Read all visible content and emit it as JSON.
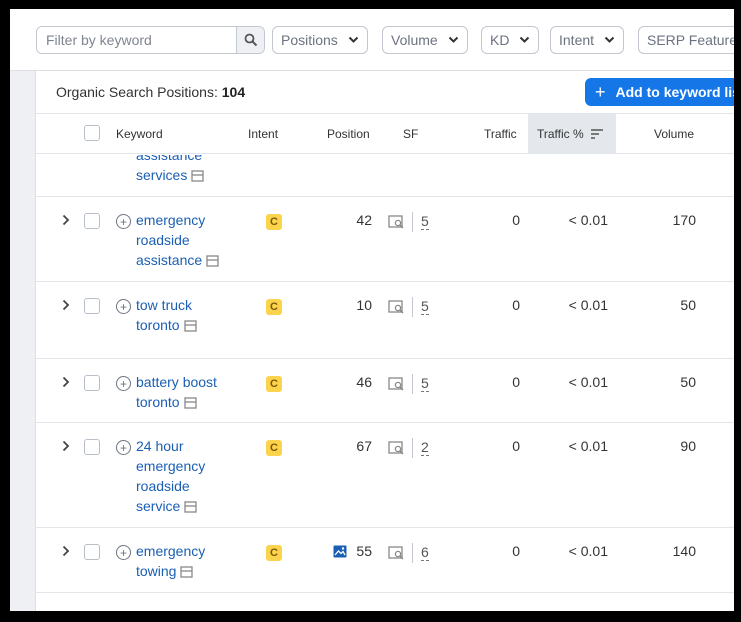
{
  "filters": {
    "search_placeholder": "Filter by keyword",
    "buttons": [
      "Positions",
      "Volume",
      "KD",
      "Intent",
      "SERP Features"
    ]
  },
  "summary": {
    "label": "Organic Search Positions:",
    "count": "104",
    "add_button": "Add to keyword list"
  },
  "table": {
    "headers": {
      "keyword": "Keyword",
      "intent": "Intent",
      "position": "Position",
      "sf": "SF",
      "traffic": "Traffic",
      "traffic_pct": "Traffic %",
      "volume": "Volume"
    },
    "partial_row": {
      "keyword": "assistance services"
    },
    "rows": [
      {
        "keyword": "emergency roadside assistance",
        "intent": "C",
        "position": "42",
        "sf": "5",
        "traffic": "0",
        "traffic_pct": "< 0.01",
        "volume": "170"
      },
      {
        "keyword": "tow truck toronto",
        "intent": "C",
        "position": "10",
        "sf": "5",
        "traffic": "0",
        "traffic_pct": "< 0.01",
        "volume": "50"
      },
      {
        "keyword": "battery boost toronto",
        "intent": "C",
        "position": "46",
        "sf": "5",
        "traffic": "0",
        "traffic_pct": "< 0.01",
        "volume": "50"
      },
      {
        "keyword": "24 hour emergency roadside service",
        "intent": "C",
        "position": "67",
        "sf": "2",
        "traffic": "0",
        "traffic_pct": "< 0.01",
        "volume": "90"
      },
      {
        "keyword": "emergency towing",
        "intent": "C",
        "position": "55",
        "sf": "6",
        "traffic": "0",
        "traffic_pct": "< 0.01",
        "volume": "140"
      }
    ]
  },
  "icons": {
    "search": "search-icon",
    "chevron": "chevron-down-icon",
    "expand": "chevron-right-icon",
    "add": "plus-circle-icon",
    "serp": "serp-features-icon",
    "image": "image-icon",
    "keyword_page": "serp-preview-icon",
    "sort": "sort-icon"
  },
  "colors": {
    "accent": "#1576e8",
    "link": "#1a5fb4",
    "intent_commercial": "#fcd34d"
  }
}
